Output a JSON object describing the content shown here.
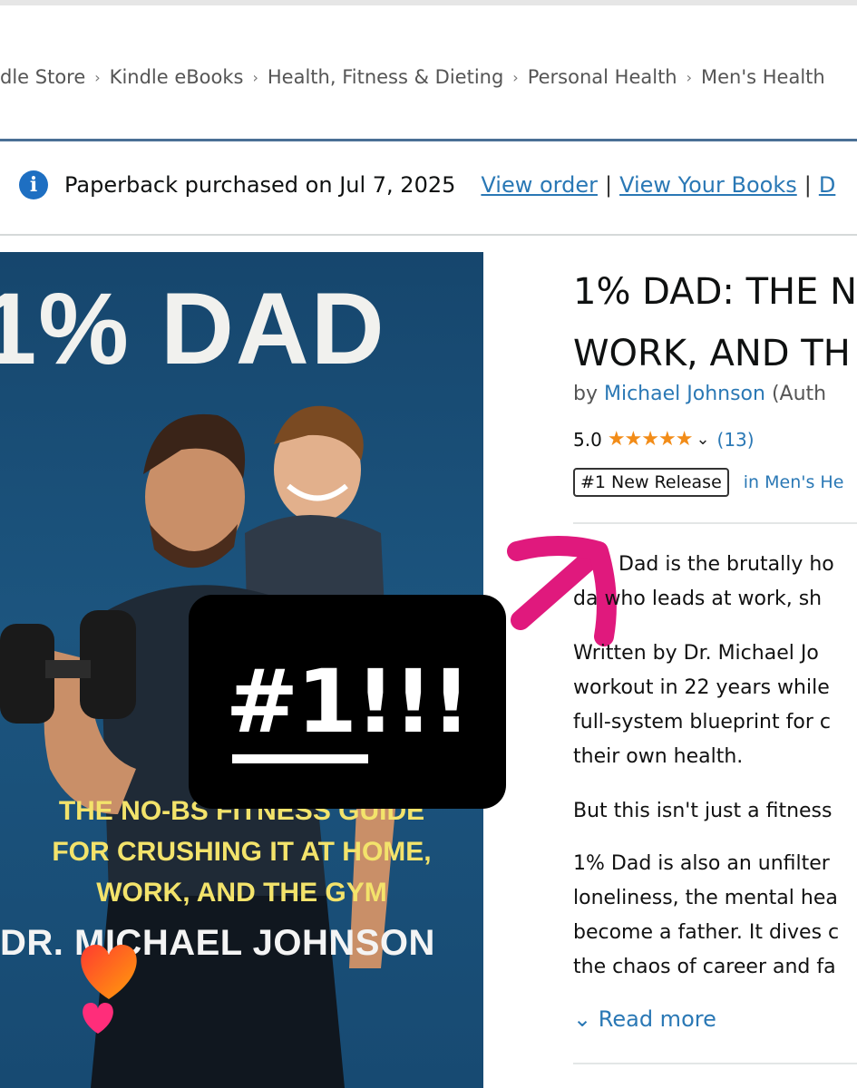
{
  "breadcrumb": [
    "dle Store",
    "Kindle eBooks",
    "Health, Fitness & Dieting",
    "Personal Health",
    "Men's Health"
  ],
  "notice": {
    "text": "Paperback purchased on Jul 7, 2025",
    "links": [
      "View order",
      "View Your Books",
      "D"
    ]
  },
  "cover": {
    "title": "1% DAD",
    "subtitle_lines": [
      "THE NO-BS FITNESS GUIDE",
      "FOR CRUSHING IT AT HOME,",
      "WORK, AND THE GYM"
    ],
    "author": "DR. MICHAEL JOHNSON"
  },
  "sticker": {
    "text": "#1!!!"
  },
  "product": {
    "title_lines": [
      "1% DAD: THE N",
      "WORK, AND TH"
    ],
    "by_prefix": "by",
    "author": "Michael Johnson",
    "author_role": "(Auth",
    "rating_value": "5.0",
    "rating_stars": 5,
    "rating_count": "(13)",
    "badge": "#1 New Release",
    "badge_category": "in Men's He",
    "description": [
      "Dad is the brutally ho",
      "da who leads at work, sh",
      "Written by Dr. Michael Jo",
      "workout in 22 years while",
      "full-system blueprint for c",
      "their own health.",
      "But this isn't just a fitness",
      "1% Dad is also an unfilter",
      "loneliness, the mental hea",
      "become a father. It dives c",
      "the chaos of career and fa"
    ],
    "read_more": "Read more"
  },
  "colors": {
    "link": "#2a78b5",
    "star": "#f28c18",
    "cover_bg": "#1c557f",
    "cover_subtitle": "#f3e36b",
    "arrow": "#e0197d"
  }
}
